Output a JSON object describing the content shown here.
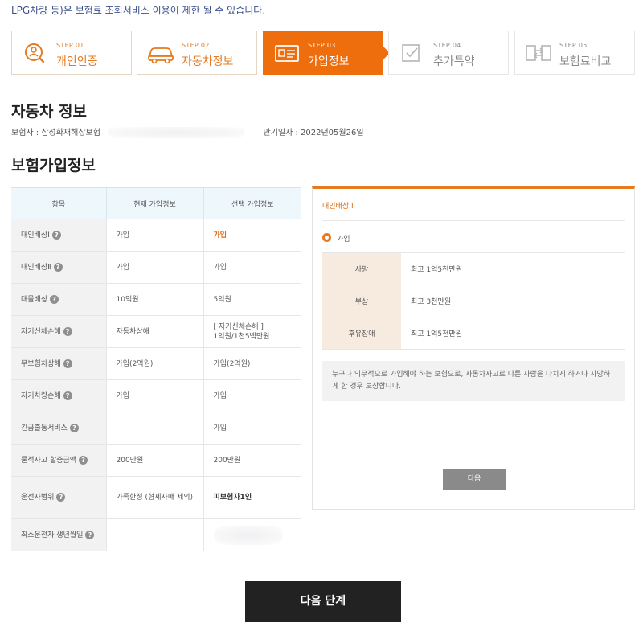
{
  "notice": "LPG차량 등)은 보험료 조회서비스 이용이 제한 될 수 있습니다.",
  "steps": [
    {
      "num": "STEP 01",
      "label": "개인인증",
      "icon": "person-search-icon",
      "state": "done"
    },
    {
      "num": "STEP 02",
      "label": "자동차정보",
      "icon": "car-icon",
      "state": "done"
    },
    {
      "num": "STEP 03",
      "label": "가입정보",
      "icon": "id-card-icon",
      "state": "active"
    },
    {
      "num": "STEP 04",
      "label": "추가특약",
      "icon": "checkbox-icon",
      "state": "inactive"
    },
    {
      "num": "STEP 05",
      "label": "보험료비교",
      "icon": "compare-icon",
      "state": "inactive"
    }
  ],
  "car_info": {
    "title": "자동차 정보",
    "insurer": "보험사 : 삼성화재해상보험",
    "expiry": "만기일자 : 2022년05월26일"
  },
  "coverage": {
    "title": "보험가입정보",
    "headers": [
      "항목",
      "현재 가입정보",
      "선택 가입정보"
    ],
    "rows": [
      {
        "item": "대인배상Ⅰ",
        "current": "가입",
        "selected": "가입",
        "style": "highlight"
      },
      {
        "item": "대인배상Ⅱ",
        "current": "가입",
        "selected": "가입"
      },
      {
        "item": "대물배상",
        "current": "10억원",
        "selected": "5억원"
      },
      {
        "item": "자기신체손해",
        "current": "자동차상해",
        "selected": "[ 자기신체손해 ]\n1억원/1천5백만원"
      },
      {
        "item": "무보험차상해",
        "current": "가입(2억원)",
        "selected": "가입(2억원)"
      },
      {
        "item": "자기차량손해",
        "current": "가입",
        "selected": "가입"
      },
      {
        "item": "긴급출동서비스",
        "current": "",
        "selected": "가입"
      },
      {
        "item": "물적사고 할증금액",
        "current": "200만원",
        "selected": "200만원"
      },
      {
        "item": "운전자범위",
        "current": "가족한정 (형제자매 제외)",
        "selected": "피보험자1인",
        "style": "bold"
      },
      {
        "item": "최소운전자 생년월일",
        "current": "",
        "selected": ""
      }
    ]
  },
  "detail": {
    "title": "대인배상 Ⅰ",
    "option": "가입",
    "items": [
      {
        "k": "사망",
        "v": "최고 1억5천만원"
      },
      {
        "k": "부상",
        "v": "최고 3천만원"
      },
      {
        "k": "후유장애",
        "v": "최고 1억5천만원"
      }
    ],
    "description": "누구나 의무적으로 가입해야 하는 보험으로, 자동차사고로 다른 사람을 다치게 하거나 사망하게 한 경우 보상합니다.",
    "next_label": "다음"
  },
  "next_step_label": "다음 단계",
  "colors": {
    "accent": "#ee6d0c",
    "accent_text": "#e06a10",
    "header_bg": "#eef7fb",
    "dark_button": "#222222"
  }
}
